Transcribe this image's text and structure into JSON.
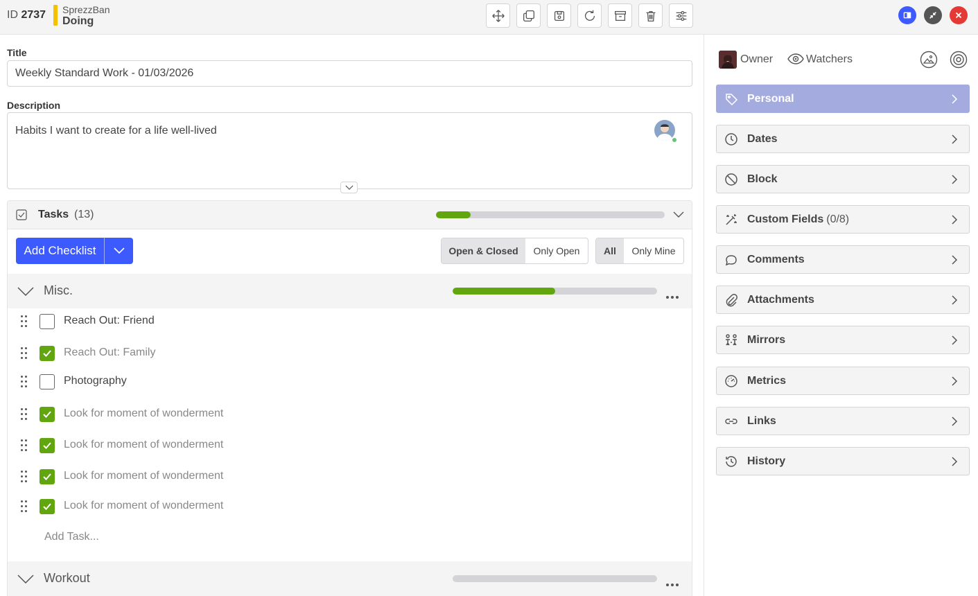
{
  "header": {
    "id_label": "ID",
    "id_value": "2737",
    "board": "SprezzBan",
    "list": "Doing",
    "status_color": "#f5c000",
    "tools": [
      "move-icon",
      "copy-icon",
      "save-icon",
      "refresh-icon",
      "archive-icon",
      "trash-icon",
      "settings-sliders-icon"
    ]
  },
  "title": {
    "label": "Title",
    "value": "Weekly Standard Work - 01/03/2026"
  },
  "description": {
    "label": "Description",
    "text": "Habits I want to create for a life well-lived"
  },
  "tasks": {
    "title": "Tasks",
    "count": "(13)",
    "progress_fraction": 0.15,
    "add_checklist_label": "Add Checklist",
    "filter_status": {
      "options": [
        "Open & Closed",
        "Only Open"
      ],
      "selected": "Open & Closed"
    },
    "filter_owner": {
      "options": [
        "All",
        "Only Mine"
      ],
      "selected": "All"
    },
    "groups": [
      {
        "name": "Misc.",
        "progress_fraction": 0.5,
        "items": [
          {
            "text": "Reach Out: Friend",
            "checked": false
          },
          {
            "text": "Reach Out: Family",
            "checked": true
          },
          {
            "text": "Photography",
            "checked": false
          },
          {
            "text": "Look for moment of wonderment",
            "checked": true
          },
          {
            "text": "Look for moment of wonderment",
            "checked": true
          },
          {
            "text": "Look for moment of wonderment",
            "checked": true
          },
          {
            "text": "Look for moment of wonderment",
            "checked": true
          }
        ],
        "add_task_placeholder": "Add Task..."
      },
      {
        "name": "Workout",
        "progress_fraction": 0.0
      }
    ]
  },
  "sidebar": {
    "owner_label": "Owner",
    "watchers_label": "Watchers",
    "sections": [
      {
        "label": "Personal",
        "icon": "tag-icon",
        "active": true
      },
      {
        "label": "Dates",
        "icon": "clock-icon"
      },
      {
        "label": "Block",
        "icon": "block-icon"
      },
      {
        "label": "Custom Fields",
        "extra": "(0/8)",
        "icon": "magic-wand-icon"
      },
      {
        "label": "Comments",
        "icon": "comment-icon"
      },
      {
        "label": "Attachments",
        "icon": "paperclip-icon"
      },
      {
        "label": "Mirrors",
        "icon": "mirror-icon"
      },
      {
        "label": "Metrics",
        "icon": "gauge-icon"
      },
      {
        "label": "Links",
        "icon": "link-icon"
      },
      {
        "label": "History",
        "icon": "history-icon"
      }
    ]
  },
  "colors": {
    "accent": "#3d5afe",
    "progress": "#61a60e",
    "active_section": "#a4acdf",
    "close": "#e53935"
  }
}
